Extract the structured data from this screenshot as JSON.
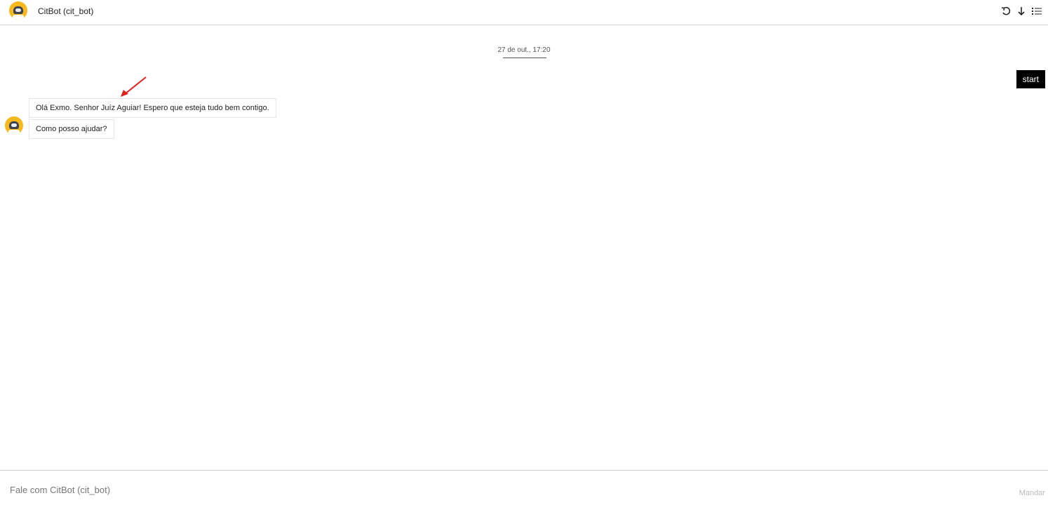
{
  "header": {
    "title": "CitBot (cit_bot)",
    "actions": [
      {
        "icon": "undo-icon"
      },
      {
        "icon": "arrow-down-icon"
      },
      {
        "icon": "list-icon"
      }
    ]
  },
  "conversation": {
    "date_separator": "27 de out., 17:20",
    "user_message": "start",
    "bot_messages": [
      "Olá Exmo. Senhor Juíz Aguiar! Espero que esteja tudo bem contigo.",
      "Como posso ajudar?"
    ]
  },
  "composer": {
    "placeholder": "Fale com CitBot (cit_bot)",
    "send_label": "Mandar"
  },
  "colors": {
    "avatar": "#f6b81a",
    "annotation_arrow": "#e0201b",
    "user_bubble": "#000000"
  }
}
